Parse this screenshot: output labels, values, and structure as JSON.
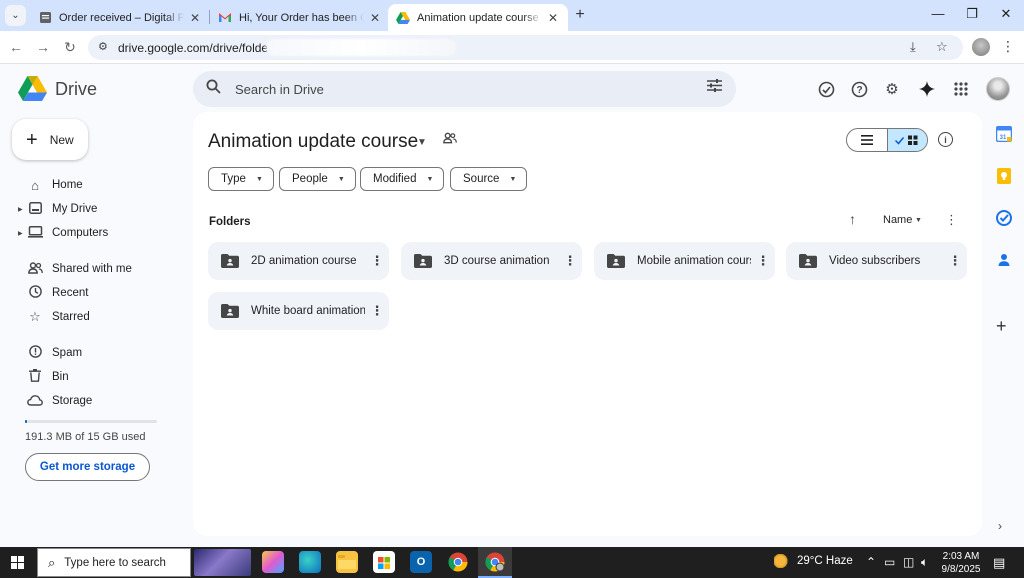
{
  "browser": {
    "tabs": [
      {
        "title": "Order received – Digital Products",
        "icon": "document-icon",
        "active": false
      },
      {
        "title": "Hi, Your Order has been Completed",
        "icon": "gmail-icon",
        "active": false
      },
      {
        "title": "Animation update course - Google Drive",
        "icon": "google-drive-icon",
        "active": true
      }
    ],
    "url": "drive.google.com/drive/folders/"
  },
  "drive": {
    "app_name": "Drive",
    "search_placeholder": "Search in Drive",
    "new_button": "New",
    "nav": [
      {
        "label": "Home",
        "icon": "home-icon"
      },
      {
        "label": "My Drive",
        "icon": "my-drive-icon",
        "expandable": true
      },
      {
        "label": "Computers",
        "icon": "computer-icon",
        "expandable": true
      },
      {
        "label": "Shared with me",
        "icon": "people-icon"
      },
      {
        "label": "Recent",
        "icon": "clock-icon"
      },
      {
        "label": "Starred",
        "icon": "star-icon"
      },
      {
        "label": "Spam",
        "icon": "spam-icon"
      },
      {
        "label": "Bin",
        "icon": "trash-icon"
      },
      {
        "label": "Storage",
        "icon": "cloud-icon"
      }
    ],
    "storage": {
      "text": "191.3 MB of 15 GB used",
      "fraction": 0.012,
      "button": "Get more storage"
    },
    "page_title": "Animation update course",
    "filters": [
      "Type",
      "People",
      "Modified",
      "Source"
    ],
    "section_label": "Folders",
    "sort_label": "Name",
    "folders": [
      "2D animation course",
      "3D course animation",
      "Mobile animation course",
      "Video subscribers",
      "White board animation"
    ]
  },
  "taskbar": {
    "search_placeholder": "Type here to search",
    "weather": "29°C  Haze",
    "time": "2:03 AM",
    "date": "9/8/2025"
  },
  "colors": {
    "accent": "#0b57d0",
    "tabstrip": "#d3e3fd",
    "chip_selected": "#c2e7ff",
    "folder_bg": "#f0f4f9"
  }
}
